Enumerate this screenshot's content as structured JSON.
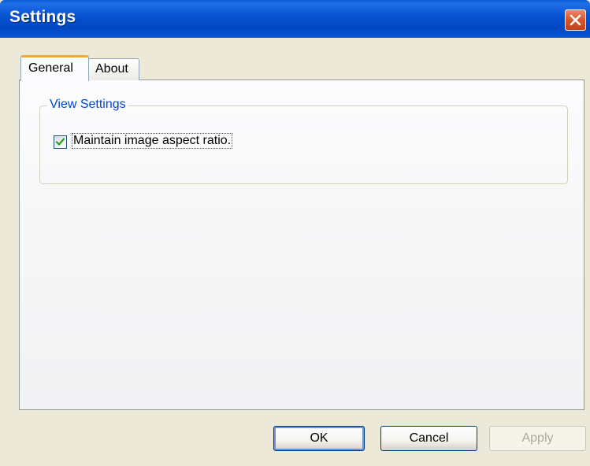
{
  "window": {
    "title": "Settings",
    "close_icon": "close-icon"
  },
  "tabs": [
    {
      "label": "General",
      "selected": true
    },
    {
      "label": "About",
      "selected": false
    }
  ],
  "view_settings": {
    "legend": "View Settings",
    "maintain_aspect": {
      "label": "Maintain image aspect ratio.",
      "checked": true
    }
  },
  "buttons": {
    "ok": "OK",
    "cancel": "Cancel",
    "apply": "Apply",
    "apply_enabled": false
  },
  "colors": {
    "titlebar": "#0450d0",
    "legend_text": "#0046d5",
    "selected_tab_accent": "#f2a83a",
    "checkmark": "#21a121",
    "close_button": "#d9542a"
  }
}
